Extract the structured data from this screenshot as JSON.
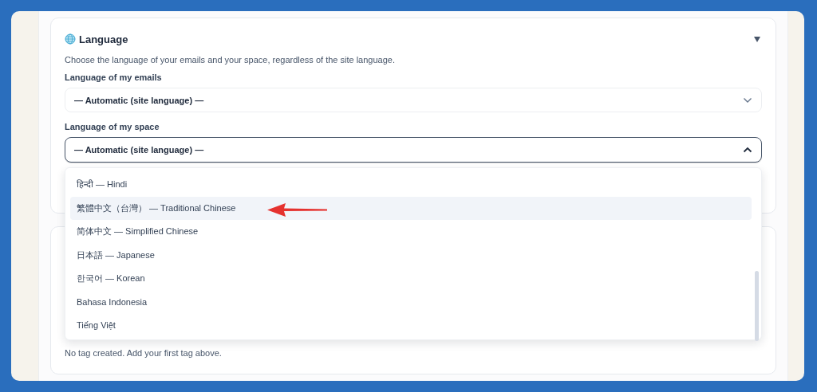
{
  "language_section": {
    "title": "Language",
    "expanded": true,
    "description": "Choose the language of your emails and your space, regardless of the site language.",
    "fields": [
      {
        "label": "Language of my emails",
        "value": "— Automatic (site language) —",
        "open": false
      },
      {
        "label": "Language of my space",
        "value": "— Automatic (site language) —",
        "open": true
      }
    ]
  },
  "dropdown_options": [
    {
      "label": "हिन्दी — Hindi",
      "highlighted": false
    },
    {
      "label": "繁體中文（台灣） — Traditional Chinese",
      "highlighted": true
    },
    {
      "label": "简体中文 — Simplified Chinese",
      "highlighted": false
    },
    {
      "label": "日本語 — Japanese",
      "highlighted": false
    },
    {
      "label": "한국어 — Korean",
      "highlighted": false
    },
    {
      "label": "Bahasa Indonesia",
      "highlighted": false
    },
    {
      "label": "Tiếng Việt",
      "highlighted": false
    }
  ],
  "tags_section": {
    "empty_message": "No tag created. Add your first tag above."
  }
}
